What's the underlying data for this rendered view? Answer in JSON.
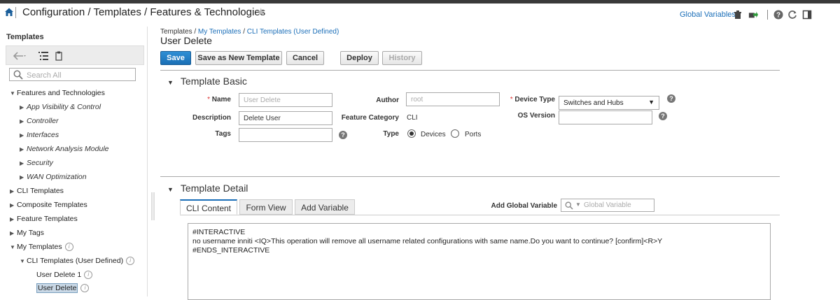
{
  "header": {
    "title": "Configuration / Templates / Features & Technologies",
    "global_variables_label": "Global Variables"
  },
  "left_panel": {
    "title": "Templates",
    "search_placeholder": "Search All",
    "tree": {
      "features": "Features and Technologies",
      "app_visibility": "App Visibility & Control",
      "controller": "Controller",
      "interfaces": "Interfaces",
      "nam": "Network Analysis Module",
      "security": "Security",
      "wan": "WAN Optimization",
      "cli_templates": "CLI Templates",
      "composite": "Composite Templates",
      "feature_templates": "Feature Templates",
      "my_tags": "My Tags",
      "my_templates": "My Templates",
      "cli_user_defined": "CLI Templates (User Defined)",
      "user_delete_1": "User Delete 1",
      "user_delete": "User Delete"
    }
  },
  "breadcrumb": {
    "root": "Templates",
    "sep": " / ",
    "my_templates": "My Templates",
    "cli_user": "CLI Templates (User Defined)"
  },
  "page": {
    "heading": "User Delete"
  },
  "toolbar": {
    "save": "Save",
    "save_as_new": "Save as New Template",
    "cancel": "Cancel",
    "deploy": "Deploy",
    "history": "History"
  },
  "template_basic": {
    "section_title": "Template Basic",
    "name_label": "Name",
    "name_placeholder": "User Delete",
    "description_label": "Description",
    "description_value": "Delete User",
    "tags_label": "Tags",
    "tags_value": "",
    "author_label": "Author",
    "author_placeholder": "root",
    "feature_category_label": "Feature Category",
    "feature_category_value": "CLI",
    "type_label": "Type",
    "type_options": [
      "Devices",
      "Ports"
    ],
    "type_selected": "Devices",
    "device_type_label": "Device Type",
    "device_type_value": "Switches and Hubs",
    "os_version_label": "OS Version",
    "os_version_value": ""
  },
  "template_detail": {
    "section_title": "Template Detail",
    "tabs": [
      "CLI Content",
      "Form View",
      "Add Variable"
    ],
    "active_tab": "CLI Content",
    "add_global_variable_label": "Add Global Variable",
    "global_variable_placeholder": "Global Variable",
    "cli_content": "#INTERACTIVE\nno username inniti <IQ>This operation will remove all username related configurations with same name.Do you want to continue? [confirm]<R>Y\n#ENDS_INTERACTIVE"
  }
}
